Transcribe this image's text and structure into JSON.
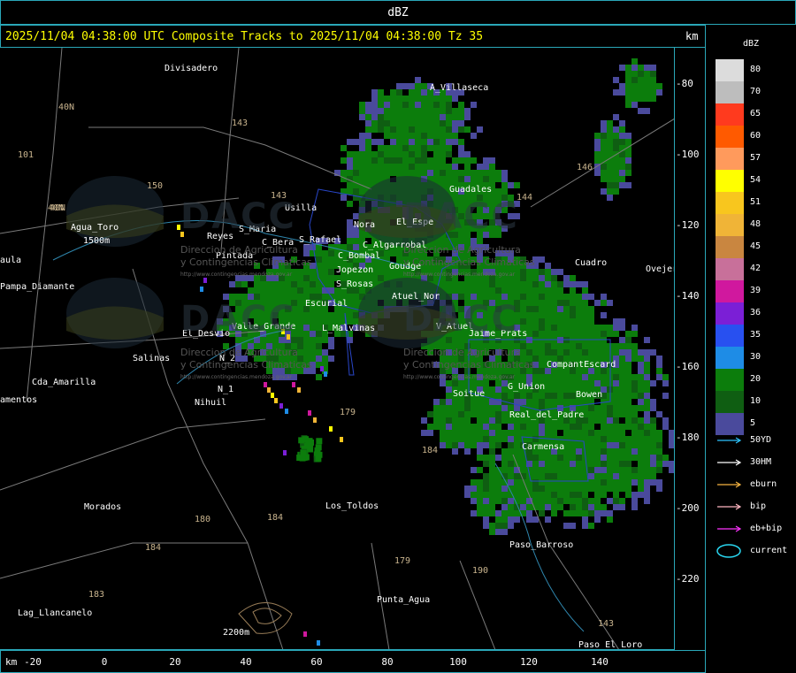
{
  "window": {
    "title": "dBZ"
  },
  "header": {
    "text": "2025/11/04 04:38:00 UTC Composite Tracks to 2025/11/04 04:38:00 Tz 35",
    "km_label": "km"
  },
  "x_axis": {
    "km_label": "km",
    "ticks": [
      "-20",
      "0",
      "20",
      "40",
      "60",
      "80",
      "100",
      "120",
      "140"
    ]
  },
  "y_axis": {
    "ticks": [
      "-80",
      "-100",
      "-120",
      "-140",
      "-160",
      "-180",
      "-200",
      "-220"
    ]
  },
  "legend": {
    "title": "dBZ",
    "colorbar": [
      {
        "value": "80",
        "color": "#dcdcdc"
      },
      {
        "value": "70",
        "color": "#bdbdbd"
      },
      {
        "value": "65",
        "color": "#ff3a1e"
      },
      {
        "value": "60",
        "color": "#ff5a00"
      },
      {
        "value": "57",
        "color": "#ff9a5c"
      },
      {
        "value": "54",
        "color": "#ffff00"
      },
      {
        "value": "51",
        "color": "#f8c61e"
      },
      {
        "value": "48",
        "color": "#f0b437"
      },
      {
        "value": "45",
        "color": "#c98640"
      },
      {
        "value": "42",
        "color": "#c8709a"
      },
      {
        "value": "39",
        "color": "#d0189e"
      },
      {
        "value": "36",
        "color": "#7b1fd6"
      },
      {
        "value": "35",
        "color": "#2850f0"
      },
      {
        "value": "30",
        "color": "#1e8ce6"
      },
      {
        "value": "20",
        "color": "#0c7d0c"
      },
      {
        "value": "10",
        "color": "#0f5e12"
      },
      {
        "value": "5",
        "color": "#4a4a9c"
      }
    ],
    "tracks": [
      {
        "label": "50YD",
        "color": "#2ec4ff",
        "kind": "arrow"
      },
      {
        "label": "30HM",
        "color": "#ffffff",
        "kind": "arrow"
      },
      {
        "label": "eburn",
        "color": "#f5b441",
        "kind": "arrow"
      },
      {
        "label": "bip",
        "color": "#ffb6c1",
        "kind": "arrow"
      },
      {
        "label": "eb+bip",
        "color": "#ff33ff",
        "kind": "arrow"
      },
      {
        "label": "current",
        "color": "#29d6f0",
        "kind": "ellipse"
      }
    ]
  },
  "places": [
    "Divisadero",
    "A_Villaseca",
    "Guadales",
    "Agua_Toro",
    "aula",
    "Pampa_Diamante",
    "Usilla",
    "Nora",
    "El_Espe",
    "Reyes",
    "S_Maria",
    "C_Bera",
    "S_Rafael",
    "C_Algarrobal",
    "Pintada",
    "C_Bombal",
    "Jopezon",
    "Goudge",
    "S_Rosas",
    "Atuel_Nor",
    "Cuadro",
    "Ovejer",
    "El_Desvio",
    "Valle_Grande",
    "Escurial",
    "L_Malvinas",
    "V_Atuel",
    "Jaime_Prats",
    "Salinas",
    "N_2",
    "N_1",
    "Nihuil",
    "Cda_Amarilla",
    "amentos",
    "Soitue",
    "G_Union",
    "CompantEscard",
    "Bowen",
    "Real_del_Padre",
    "Carmensa",
    "Los_Toldos",
    "Morados",
    "Paso_Barroso",
    "Punta_Agua",
    "Lag_Llancanelo",
    "Paso_El_Loro",
    "2200m",
    "1500m"
  ],
  "routes": [
    "40N",
    "101",
    "143",
    "146",
    "40N",
    "150",
    "143",
    "179",
    "184",
    "184",
    "180",
    "184",
    "183",
    "179",
    "190",
    "143",
    "40N",
    "144"
  ],
  "watermark": {
    "brand": "DACC",
    "line1": "Direccion de Agricultura",
    "line2": "y Contingencias Climaticas",
    "url": "http://www.contingencias.mendoza.gov.ar"
  }
}
